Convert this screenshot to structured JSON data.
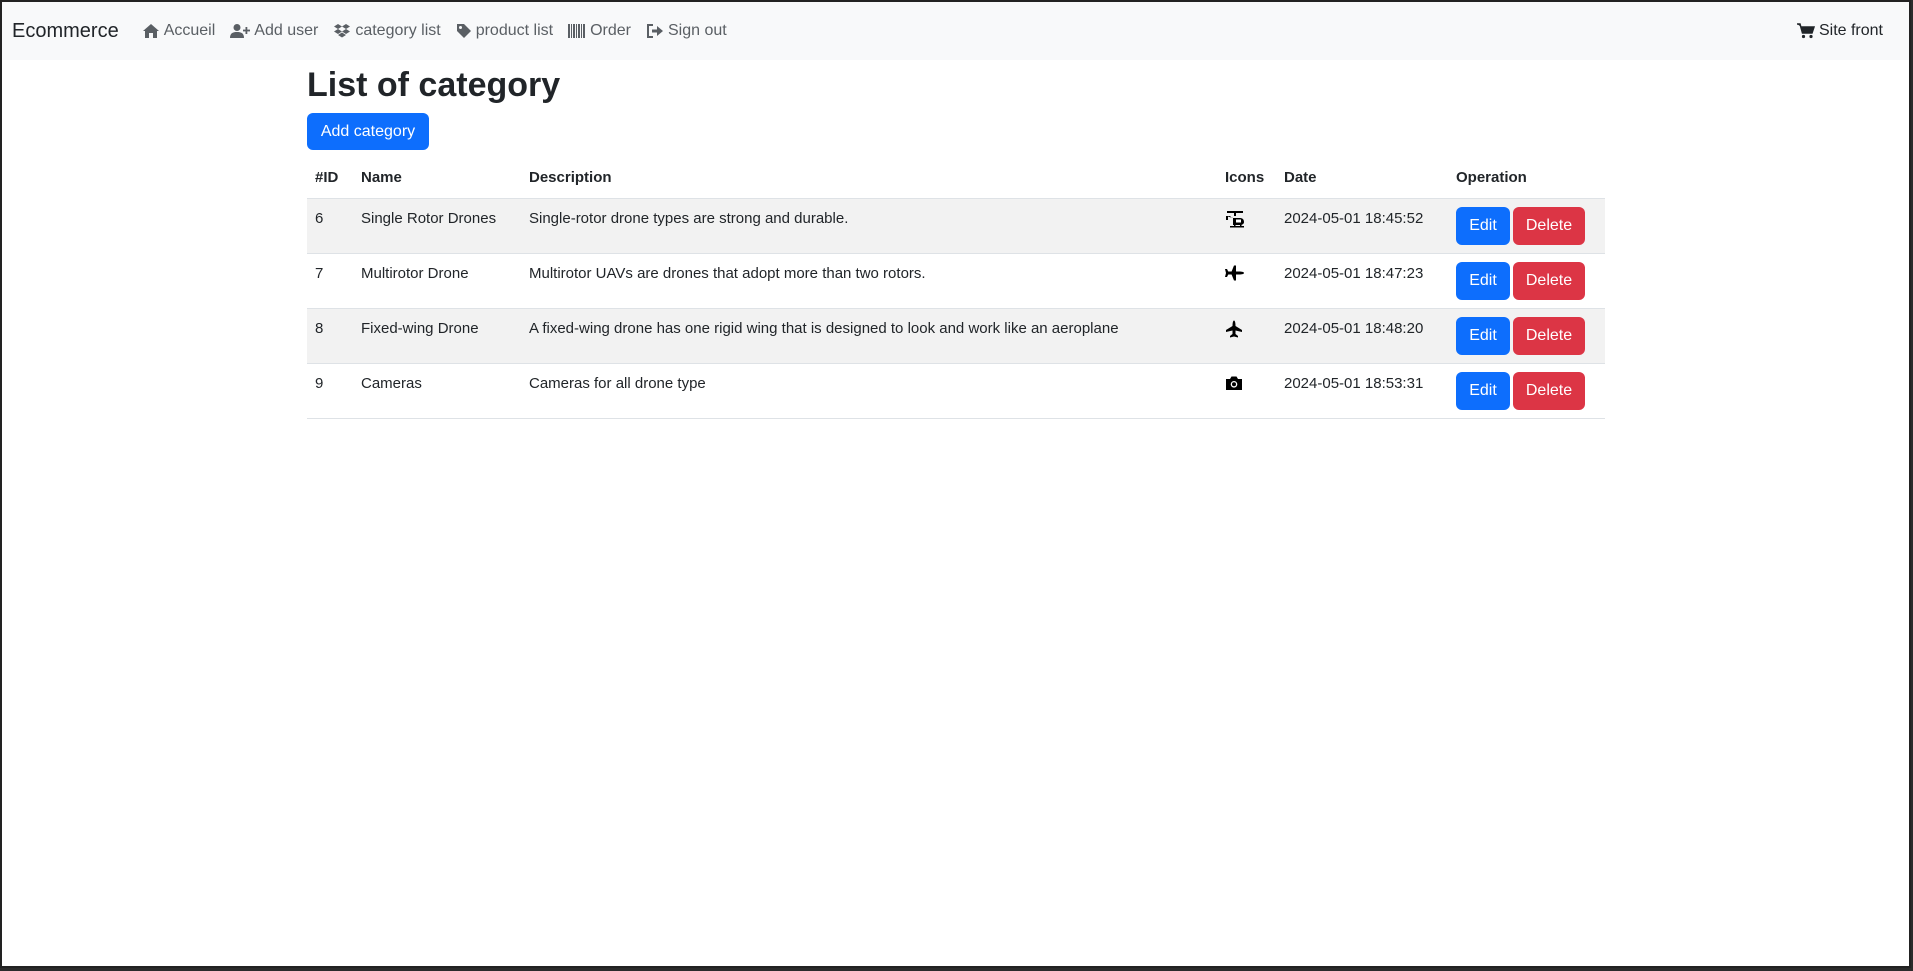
{
  "navbar": {
    "brand": "Ecommerce",
    "items": [
      {
        "label": "Accueil",
        "icon": "home-icon"
      },
      {
        "label": "Add user",
        "icon": "user-plus-icon"
      },
      {
        "label": "category list",
        "icon": "dropbox-icon"
      },
      {
        "label": "product list",
        "icon": "tag-icon"
      },
      {
        "label": "Order",
        "icon": "barcode-icon"
      },
      {
        "label": "Sign out",
        "icon": "sign-out-icon"
      }
    ],
    "right": {
      "label": "Site front",
      "icon": "shopping-cart-icon"
    }
  },
  "page": {
    "title": "List of category",
    "add_button": "Add category"
  },
  "table": {
    "headers": [
      "#ID",
      "Name",
      "Description",
      "Icons",
      "Date",
      "Operation"
    ],
    "rows": [
      {
        "id": "6",
        "name": "Single Rotor Drones",
        "description": "Single-rotor drone types are strong and durable.",
        "icon": "helicopter-icon",
        "date": "2024-05-01 18:45:52",
        "edit": "Edit",
        "delete": "Delete"
      },
      {
        "id": "7",
        "name": "Multirotor Drone",
        "description": "Multirotor UAVs are drones that adopt more than two rotors.",
        "icon": "plane-icon",
        "date": "2024-05-01 18:47:23",
        "edit": "Edit",
        "delete": "Delete"
      },
      {
        "id": "8",
        "name": "Fixed-wing Drone",
        "description": "A fixed-wing drone has one rigid wing that is designed to look and work like an aeroplane",
        "icon": "fighter-jet-icon",
        "date": "2024-05-01 18:48:20",
        "edit": "Edit",
        "delete": "Delete"
      },
      {
        "id": "9",
        "name": "Cameras",
        "description": "Cameras for all drone type",
        "icon": "camera-icon",
        "date": "2024-05-01 18:53:31",
        "edit": "Edit",
        "delete": "Delete"
      }
    ]
  },
  "colors": {
    "primary": "#0d6efd",
    "danger": "#dc3545",
    "navbar_bg": "#f8f9fa",
    "stripe": "#f2f2f2"
  }
}
